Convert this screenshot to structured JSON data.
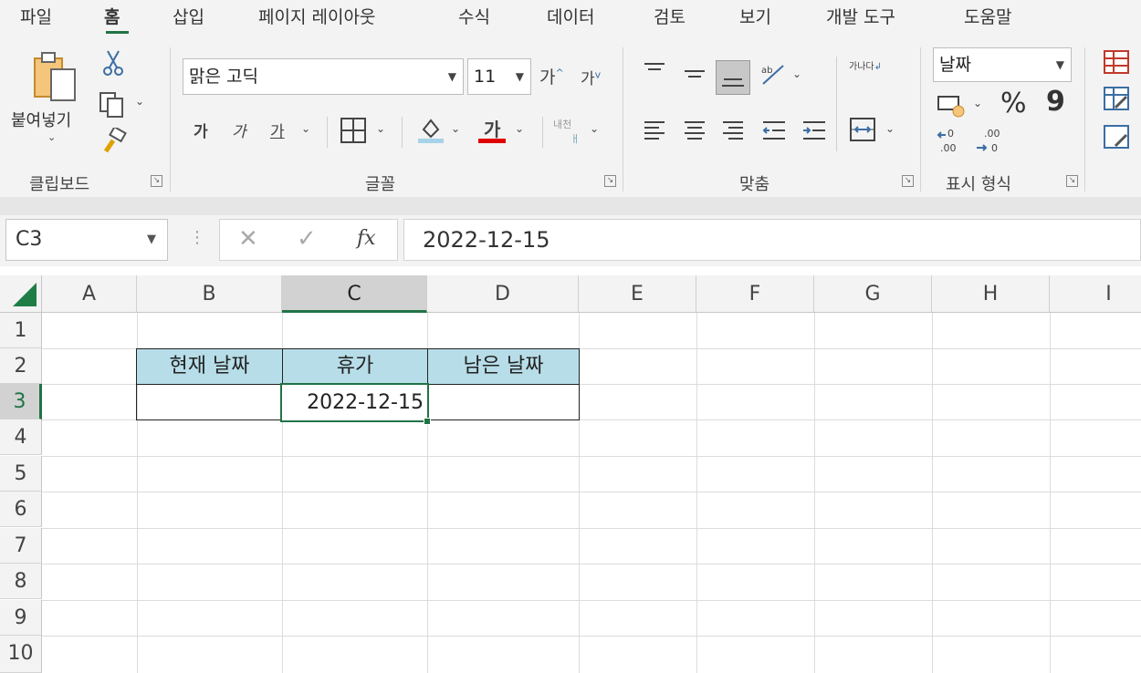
{
  "menu": {
    "tabs": [
      "파일",
      "홈",
      "삽입",
      "페이지 레이아웃",
      "수식",
      "데이터",
      "검토",
      "보기",
      "개발 도구",
      "도움말"
    ],
    "active": "홈"
  },
  "ribbon": {
    "clipboard": {
      "paste_label": "붙여넣기",
      "group_label": "클립보드"
    },
    "font": {
      "font_name": "맑은 고딕",
      "font_size": "11",
      "group_label": "글꼴",
      "bold": "가",
      "italic": "가",
      "underline": "가",
      "font_color_glyph": "가",
      "grow_glyph": "가",
      "shrink_glyph": "가",
      "phonetic_glyph": "내천"
    },
    "alignment": {
      "group_label": "맞춤",
      "wrap_glyph": "가나다"
    },
    "number": {
      "format_value": "날짜",
      "group_label": "표시 형식",
      "percent": "%",
      "comma": "9"
    }
  },
  "formula_bar": {
    "name_box": "C3",
    "formula": "2022-12-15",
    "fx": "fx"
  },
  "grid": {
    "columns": [
      "A",
      "B",
      "C",
      "D",
      "E",
      "F",
      "G",
      "H",
      "I"
    ],
    "rows": [
      "1",
      "2",
      "3",
      "4",
      "5",
      "6",
      "7",
      "8",
      "9",
      "10"
    ],
    "selected_column": "C",
    "selected_row": "3",
    "table": {
      "headers": [
        "현재 날짜",
        "휴가",
        "남은 날짜"
      ],
      "row3": [
        "",
        "2022-12-15",
        ""
      ]
    }
  },
  "colors": {
    "accent": "#217346",
    "header_fill": "#b7dde8",
    "font_color_bar": "#e00000",
    "fill_color_bar": "#a7d3e8"
  }
}
